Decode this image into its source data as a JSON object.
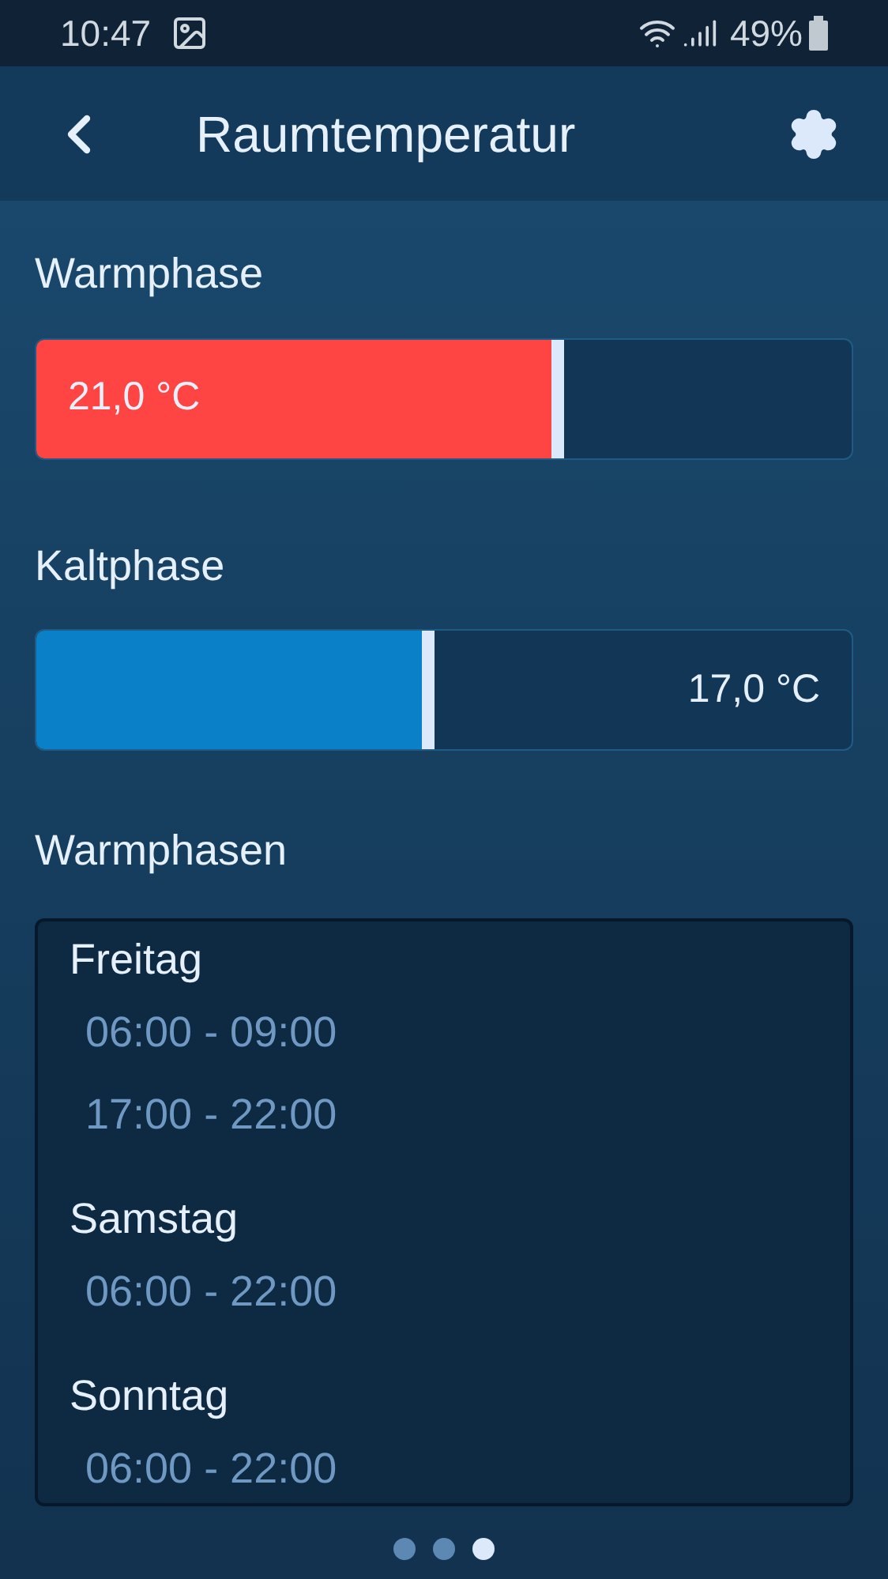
{
  "status_bar": {
    "time": "10:47",
    "battery": "49%"
  },
  "header": {
    "title": "Raumtemperatur"
  },
  "phases": [
    {
      "kind": "warm",
      "label": "Warmphase",
      "reading": "21,0 °C",
      "level": 0.64,
      "color": "#ff4444"
    },
    {
      "kind": "cold",
      "label": "Kaltphase",
      "reading": "17,0 °C",
      "level": 0.48,
      "color": "#0a80c8"
    }
  ],
  "schedule": {
    "title": "Warmphasen",
    "days": [
      {
        "day": "Freitag",
        "times": [
          "06:00 - 09:00",
          "17:00 - 22:00"
        ]
      },
      {
        "day": "Samstag",
        "times": [
          "06:00 - 22:00"
        ]
      },
      {
        "day": "Sonntag",
        "times": [
          "06:00 - 22:00"
        ]
      }
    ]
  },
  "pages": [
    {
      "selected": false
    },
    {
      "selected": false
    },
    {
      "selected": true
    }
  ]
}
